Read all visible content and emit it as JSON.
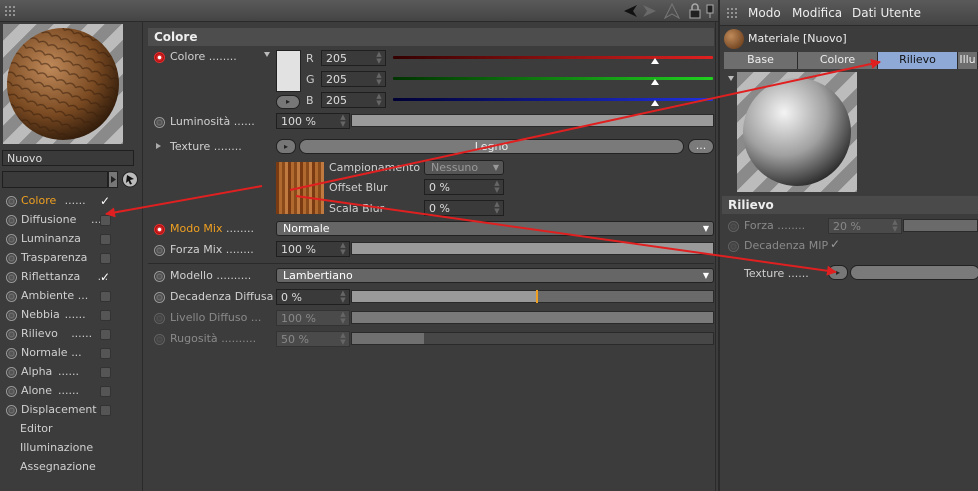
{
  "preview_name": "Nuovo",
  "channels": [
    {
      "label": "Colore",
      "dots": "......",
      "state": "checked",
      "active": true
    },
    {
      "label": "Diffusione",
      "dots": "...",
      "state": "box"
    },
    {
      "label": "Luminanza",
      "dots": "",
      "state": "box"
    },
    {
      "label": "Trasparenza",
      "dots": "",
      "state": "box"
    },
    {
      "label": "Riflettanza",
      "dots": "...",
      "state": "checked"
    },
    {
      "label": "Ambiente",
      "dots": "...",
      "state": "box"
    },
    {
      "label": "Nebbia",
      "dots": "......",
      "state": "box"
    },
    {
      "label": "Rilievo",
      "dots": "......",
      "state": "box"
    },
    {
      "label": "Normale",
      "dots": "...",
      "state": "box"
    },
    {
      "label": "Alpha",
      "dots": "......",
      "state": "box"
    },
    {
      "label": "Alone",
      "dots": "......",
      "state": "box"
    },
    {
      "label": "Displacement",
      "dots": "",
      "state": "box"
    }
  ],
  "extra_items": [
    "Editor",
    "Illuminazione",
    "Assegnazione"
  ],
  "colore": {
    "section_title": "Colore",
    "label": "Colore",
    "dots": "........",
    "r_label": "R",
    "g_label": "G",
    "b_label": "B",
    "r": "205",
    "g": "205",
    "b": "205",
    "luminosita_label": "Luminosità",
    "luminosita_dots": "......",
    "luminosita": "100 %",
    "texture_label": "Texture",
    "texture_dots": "........",
    "texture_name": "Legno",
    "more_button": "...",
    "campionamento_label": "Campionamento",
    "campionamento": "Nessuno",
    "offset_blur_label": "Offset Blur",
    "offset_blur": "0 %",
    "scala_blur_label": "Scala Blur",
    "scala_blur": "0 %",
    "modo_mix_label": "Modo Mix",
    "modo_mix_dots": "........",
    "modo_mix": "Normale",
    "forza_mix_label": "Forza Mix",
    "forza_mix_dots": "........",
    "forza_mix": "100 %",
    "modello_label": "Modello",
    "modello_dots": "..........",
    "modello": "Lambertiano",
    "decadenza_label": "Decadenza Diffusa",
    "decadenza": "0 %",
    "livello_label": "Livello Diffuso",
    "livello_dots": "...",
    "livello": "100 %",
    "rugosita_label": "Rugosità",
    "rugosita_dots": "..........",
    "rugosita": "50 %",
    "rugosita_level": 0.2
  },
  "right": {
    "menu": [
      "Modo",
      "Modifica",
      "Dati Utente"
    ],
    "material_title": "Materiale [Nuovo]",
    "tabs": [
      "Base",
      "Colore",
      "Rilievo",
      "Illu"
    ],
    "selected_tab": 2,
    "section_title": "Rilievo",
    "forza_label": "Forza",
    "forza_dots": "........",
    "forza": "20 %",
    "decadenza_mip_label": "Decadenza MIP",
    "texture_label": "Texture",
    "texture_dots": "......"
  },
  "colors": {
    "accent_red": "#e02020",
    "tab_selected": "#8ea9d6",
    "label_orange": "#f0a020"
  }
}
